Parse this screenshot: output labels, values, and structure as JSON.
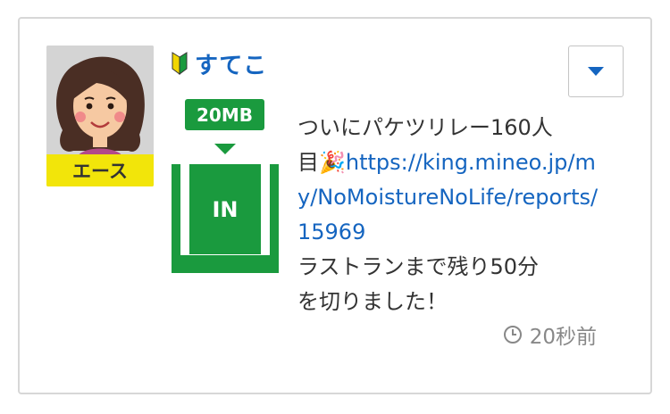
{
  "post": {
    "user": {
      "name": "すてこ",
      "rank": "エース",
      "beginner_icon": "beginner-mark-icon",
      "avatar_icon": "avatar-woman-icon"
    },
    "data_badge": "20MB",
    "transfer_label": "IN",
    "text_before_link_1": "ついにパケツリレー160人",
    "text_before_link_2": "目",
    "emoji": "🎉",
    "link_text": "https://king.mineo.jp/my/NoMoistureNoLife/reports/15969",
    "text_after_link": "ラストランまで残り50分\nを切りました！",
    "timestamp": "20秒前",
    "menu_icon": "caret-down-icon"
  },
  "colors": {
    "accent_green": "#1a9a3e",
    "link_blue": "#1565c0",
    "rank_yellow": "#f2e50a"
  }
}
